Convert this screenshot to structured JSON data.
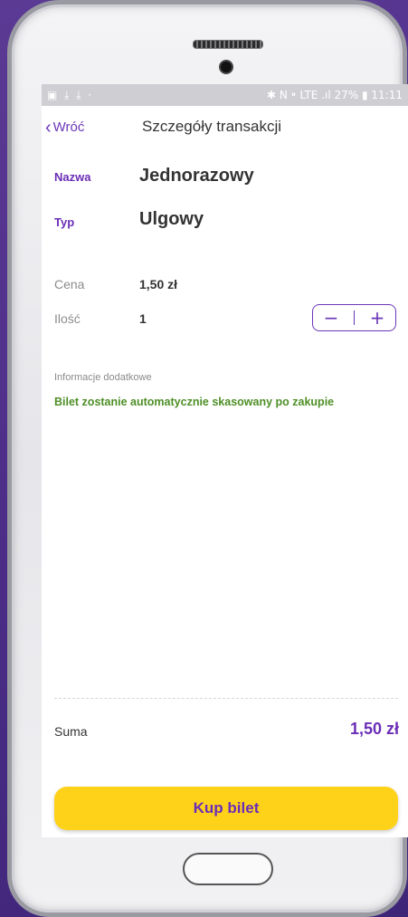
{
  "statusbar": {
    "left_icons": "▣ ⤓ ⤓ ·",
    "right_text": "✱ N ⁍ LTE .ıl 27% ▮ 11:11"
  },
  "header": {
    "back_label": "Wróć",
    "title": "Szczegóły transakcji"
  },
  "ticket": {
    "name_label": "Nazwa",
    "name_value": "Jednorazowy",
    "type_label": "Typ",
    "type_value": "Ulgowy",
    "price_label": "Cena",
    "price_value": "1,50 zł",
    "qty_label": "Ilość",
    "qty_value": "1",
    "minus": "−",
    "plus": "+"
  },
  "info": {
    "label": "Informacje dodatkowe",
    "text": "Bilet zostanie automatycznie skasowany po zakupie"
  },
  "summary": {
    "label": "Suma",
    "value": "1,50 zł"
  },
  "buy_button": {
    "label": "Kup bilet",
    "color": "#ffd21a"
  },
  "colors": {
    "accent": "#6a2db6",
    "info_green": "#4e8f27",
    "background": "#4a2c86"
  }
}
